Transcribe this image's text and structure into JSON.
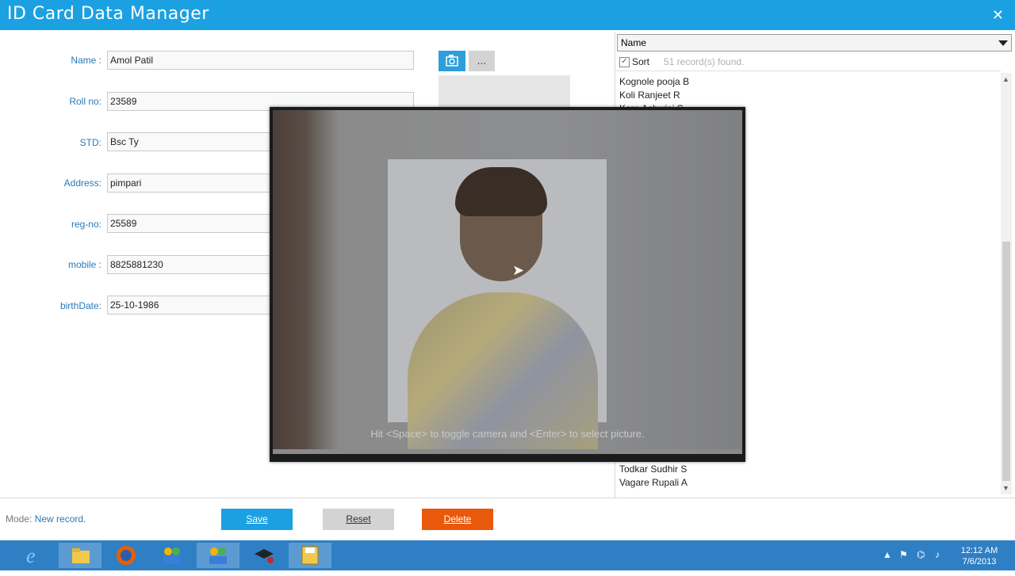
{
  "app": {
    "title": "ID Card Data Manager",
    "close_icon": "✕"
  },
  "form": {
    "fields": [
      {
        "label": "Name :",
        "value": "Amol Patil"
      },
      {
        "label": "Roll no:",
        "value": "23589"
      },
      {
        "label": "STD:",
        "value": "Bsc Ty"
      },
      {
        "label": "Address:",
        "value": "pimpari"
      },
      {
        "label": "reg-no:",
        "value": "25589"
      },
      {
        "label": "mobile :",
        "value": "8825881230"
      },
      {
        "label": "birthDate:",
        "value": "25-10-1986"
      }
    ],
    "camera_icon": "📷",
    "browse_label": "..."
  },
  "right": {
    "sort_select": "Name",
    "sort_label": "Sort",
    "sort_checked": "✓",
    "record_count": "51 record(s) found.",
    "list": [
      "Kognole pooja  B",
      "Koli Ranjeet R",
      "Kore Ashwini S",
      "Todkar Sudhir S",
      "Vagare Rupali A"
    ]
  },
  "footer": {
    "mode_label": "Mode:",
    "mode_value": "New record.",
    "save": "Save",
    "reset": "Reset",
    "delete": "Delete"
  },
  "camera_overlay": {
    "hint": "Hit <Space> to toggle camera and <Enter> to select picture."
  },
  "taskbar": {
    "apps": [
      "internet-explorer-icon",
      "file-explorer-icon",
      "firefox-icon",
      "users-app-icon",
      "users-app-2-icon",
      "graduation-app-icon",
      "save-app-icon"
    ],
    "time": "12:12 AM",
    "date": "7/6/2013"
  },
  "colors": {
    "accent": "#1ba1e2",
    "delete": "#e8590c",
    "label": "#2a7ab8"
  }
}
